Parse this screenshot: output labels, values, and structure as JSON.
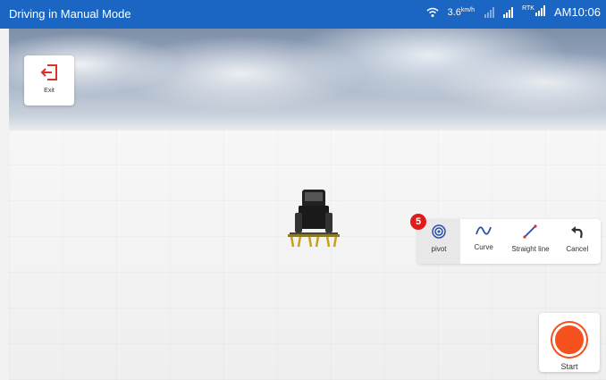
{
  "status_bar": {
    "title": "Driving in Manual Mode",
    "speed": "3.6",
    "speed_unit": "km/h",
    "rtk_label": "RTK",
    "time": "AM10:06"
  },
  "exit": {
    "label": "Exit"
  },
  "toolbar": {
    "badge": "5",
    "items": [
      {
        "label": "pivot",
        "icon": "pivot-icon"
      },
      {
        "label": "Curve",
        "icon": "curve-icon"
      },
      {
        "label": "Straight line",
        "icon": "straight-line-icon"
      },
      {
        "label": "Cancel",
        "icon": "undo-icon"
      }
    ]
  },
  "start": {
    "label": "Start"
  },
  "colors": {
    "status_bar": "#1a66c2",
    "exit_icon": "#d9322b",
    "start": "#f4511e",
    "badge": "#e01b1b",
    "icon_blue": "#2b4fa8"
  }
}
